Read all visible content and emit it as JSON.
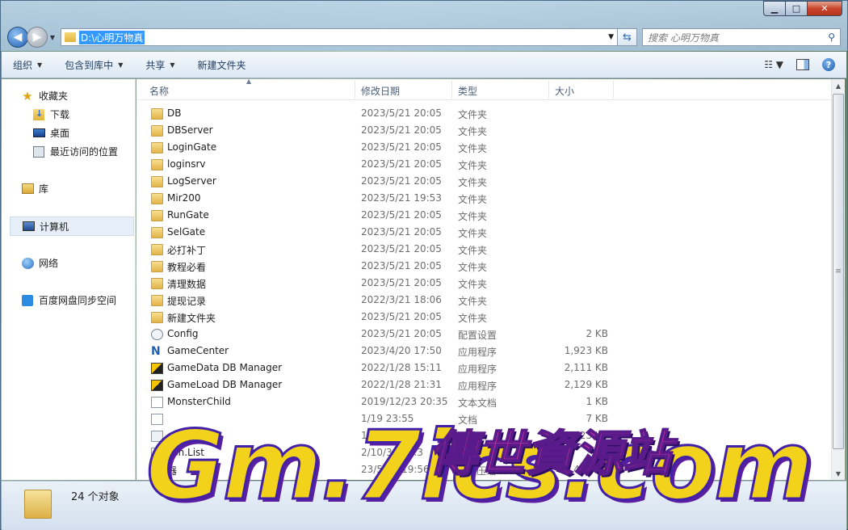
{
  "window": {
    "address_path": "D:\\心明万物真",
    "search_placeholder": "搜索 心明万物真"
  },
  "caption_buttons": {
    "minimize": "▁",
    "maximize": "□",
    "close": "✕"
  },
  "toolbar": {
    "organize": "组织",
    "include_in_library": "包含到库中",
    "share": "共享",
    "new_folder": "新建文件夹"
  },
  "nav": {
    "favorites": "收藏夹",
    "downloads": "下载",
    "desktop": "桌面",
    "recent": "最近访问的位置",
    "libraries": "库",
    "computer": "计算机",
    "network": "网络",
    "baidu": "百度网盘同步空间"
  },
  "columns": {
    "name": "名称",
    "date": "修改日期",
    "type": "类型",
    "size": "大小"
  },
  "files": [
    {
      "name": "DB",
      "date": "2023/5/21 20:05",
      "type": "文件夹",
      "size": "",
      "icon": "folder-icon"
    },
    {
      "name": "DBServer",
      "date": "2023/5/21 20:05",
      "type": "文件夹",
      "size": "",
      "icon": "folder-icon"
    },
    {
      "name": "LoginGate",
      "date": "2023/5/21 20:05",
      "type": "文件夹",
      "size": "",
      "icon": "folder-icon"
    },
    {
      "name": "loginsrv",
      "date": "2023/5/21 20:05",
      "type": "文件夹",
      "size": "",
      "icon": "folder-icon"
    },
    {
      "name": "LogServer",
      "date": "2023/5/21 20:05",
      "type": "文件夹",
      "size": "",
      "icon": "folder-icon"
    },
    {
      "name": "Mir200",
      "date": "2023/5/21 19:53",
      "type": "文件夹",
      "size": "",
      "icon": "folder-icon"
    },
    {
      "name": "RunGate",
      "date": "2023/5/21 20:05",
      "type": "文件夹",
      "size": "",
      "icon": "folder-icon"
    },
    {
      "name": "SelGate",
      "date": "2023/5/21 20:05",
      "type": "文件夹",
      "size": "",
      "icon": "folder-icon"
    },
    {
      "name": "必打补丁",
      "date": "2023/5/21 20:05",
      "type": "文件夹",
      "size": "",
      "icon": "folder-icon"
    },
    {
      "name": "教程必看",
      "date": "2023/5/21 20:05",
      "type": "文件夹",
      "size": "",
      "icon": "folder-icon"
    },
    {
      "name": "清理数据",
      "date": "2023/5/21 20:05",
      "type": "文件夹",
      "size": "",
      "icon": "folder-icon"
    },
    {
      "name": "提现记录",
      "date": "2022/3/21 18:06",
      "type": "文件夹",
      "size": "",
      "icon": "folder-icon"
    },
    {
      "name": "新建文件夹",
      "date": "2023/5/21 20:05",
      "type": "文件夹",
      "size": "",
      "icon": "folder-icon"
    },
    {
      "name": "Config",
      "date": "2023/5/21 20:05",
      "type": "配置设置",
      "size": "2 KB",
      "icon": "config-icon"
    },
    {
      "name": "GameCenter",
      "date": "2023/4/20 17:50",
      "type": "应用程序",
      "size": "1,923 KB",
      "icon": "gamecenter-icon"
    },
    {
      "name": "GameData DB Manager",
      "date": "2022/1/28 15:11",
      "type": "应用程序",
      "size": "2,111 KB",
      "icon": "db-manager-icon"
    },
    {
      "name": "GameLoad DB Manager",
      "date": "2022/1/28 21:31",
      "type": "应用程序",
      "size": "2,129 KB",
      "icon": "db-manager-icon"
    },
    {
      "name": "MonsterChild",
      "date": "2019/12/23 20:35",
      "type": "文本文档",
      "size": "1 KB",
      "icon": "text-file-icon"
    },
    {
      "name": "",
      "date": "1/19 23:55",
      "type": "文档",
      "size": "7 KB",
      "icon": "text-file-icon"
    },
    {
      "name": "qlite3.dll",
      "date": "1/28 4:29",
      "type": "",
      "size": "923 KB",
      "icon": "dll-icon"
    },
    {
      "name": "ash.List",
      "date": "2/10/30 20:3",
      "type": "本文档",
      "size": "",
      "icon": "text-file-icon"
    },
    {
      "name": "器",
      "date": "23/5/21 19:56",
      "type": "360压缩 RAR 文件",
      "size": "483 KB",
      "icon": "rar-icon"
    }
  ],
  "status": {
    "count_text": "24 个对象"
  },
  "watermark": {
    "main": "Gm.7ics.com",
    "cn": "傳世資源站"
  }
}
